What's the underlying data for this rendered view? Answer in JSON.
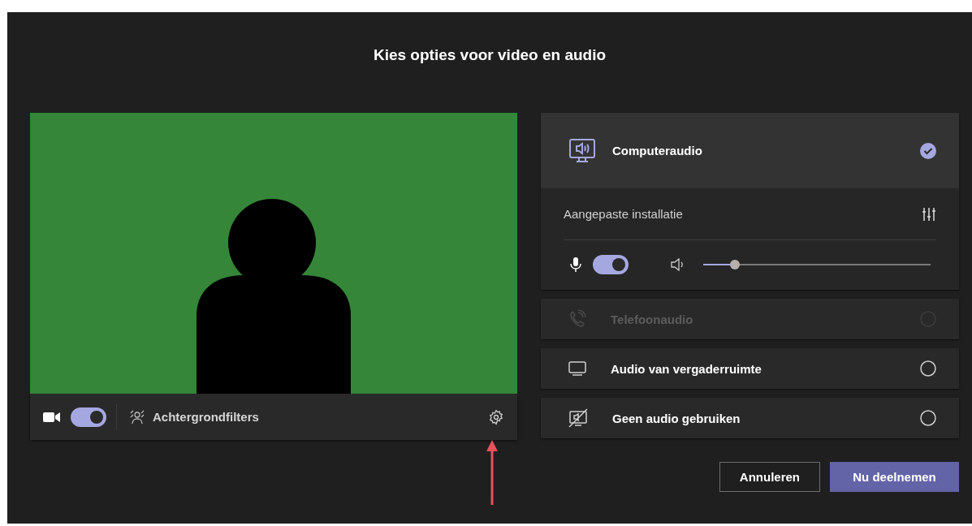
{
  "title": "Kies opties voor video en audio",
  "video": {
    "camera_on": true,
    "filters_label": "Achtergrondfilters"
  },
  "audio_options": [
    {
      "kind": "computer",
      "label": "Computeraudio",
      "selected": true,
      "disabled": false
    },
    {
      "kind": "phone",
      "label": "Telefoonaudio",
      "selected": false,
      "disabled": true
    },
    {
      "kind": "room",
      "label": "Audio van vergaderruimte",
      "selected": false,
      "disabled": false
    },
    {
      "kind": "none",
      "label": "Geen audio gebruiken",
      "selected": false,
      "disabled": false
    }
  ],
  "audio_setup": {
    "label": "Aangepaste installatie",
    "mic_on": true,
    "level": 0.14
  },
  "buttons": [
    {
      "kind": "secondary",
      "label": "Annuleren"
    },
    {
      "kind": "primary",
      "label": "Nu deelnemen"
    }
  ]
}
